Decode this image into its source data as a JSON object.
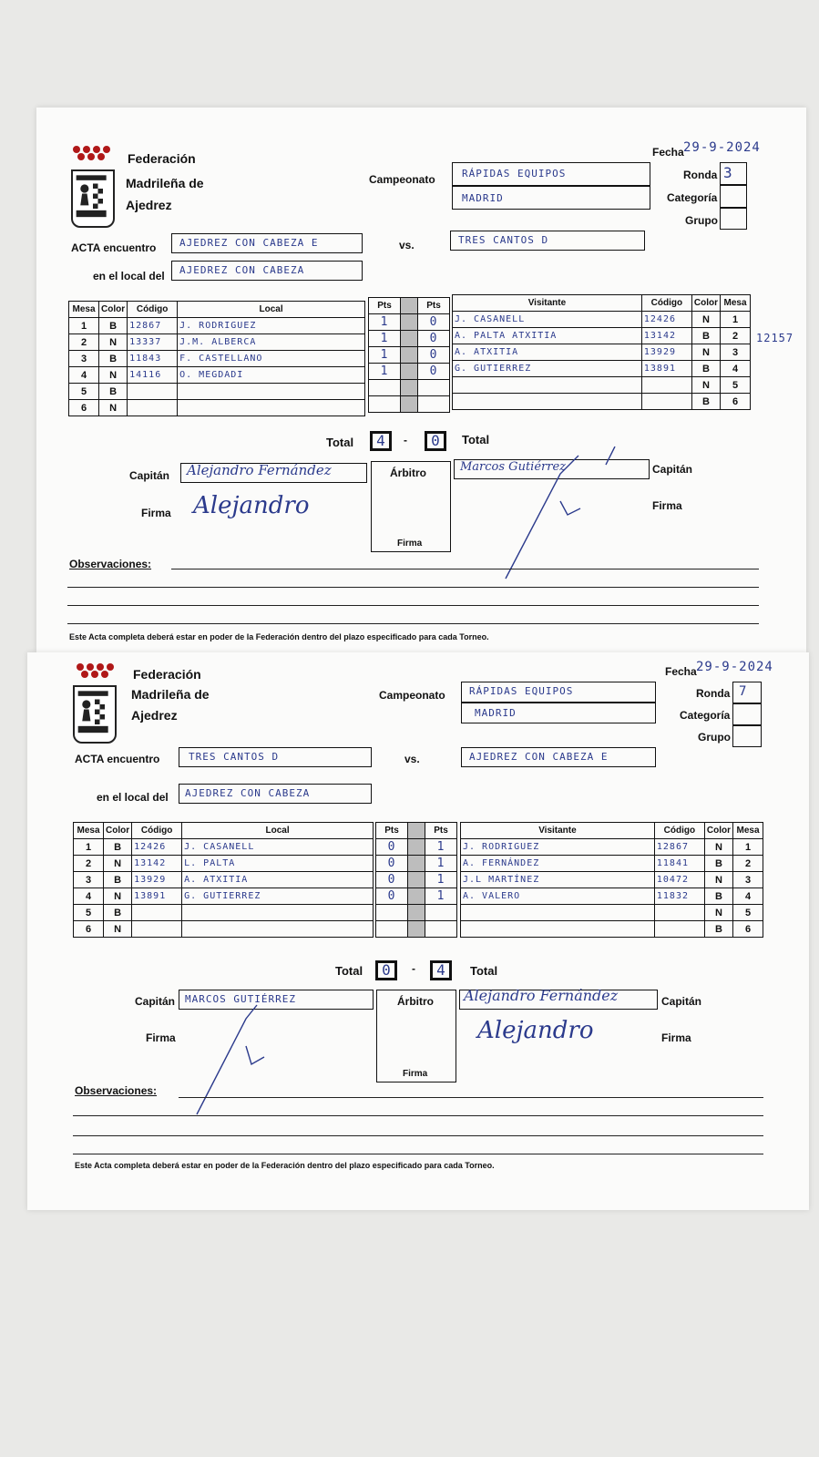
{
  "forms": [
    {
      "federation": {
        "line1": "Federación",
        "line2": "Madrileña de",
        "line3": "Ajedrez"
      },
      "fecha_label": "Fecha",
      "fecha_value": "29-9-2024",
      "campeonato_label": "Campeonato",
      "campeonato_line1": "RÁPIDAS EQUIPOS",
      "campeonato_line2": "MADRID",
      "ronda_label": "Ronda",
      "ronda_value": "3",
      "categoria_label": "Categoría",
      "categoria_value": "",
      "grupo_label": "Grupo",
      "grupo_value": "",
      "acta_label": "ACTA encuentro",
      "acta_local": "AJEDREZ CON CABEZA E",
      "vs_label": "vs.",
      "acta_visitante": "TRES CANTOS D",
      "local_label": "en el local del",
      "local_value": "AJEDREZ CON CABEZA",
      "headers": {
        "mesa": "Mesa",
        "color": "Color",
        "codigo": "Código",
        "local": "Local",
        "pts": "Pts",
        "visitante": "Visitante"
      },
      "rows": [
        {
          "mesa": "1",
          "color_l": "B",
          "codigo_l": "12867",
          "local": "J. RODRIGUEZ",
          "pts_l": "1",
          "pts_v": "0",
          "visitante": "J. CASANELL",
          "codigo_v": "12426",
          "color_v": "N"
        },
        {
          "mesa": "2",
          "color_l": "N",
          "codigo_l": "13337",
          "local": "J.M. ALBERCA",
          "pts_l": "1",
          "pts_v": "0",
          "visitante": "A. PALTA ATXITIA",
          "codigo_v": "13142",
          "color_v": "B"
        },
        {
          "mesa": "3",
          "color_l": "B",
          "codigo_l": "11843",
          "local": "F. CASTELLANO",
          "pts_l": "1",
          "pts_v": "0",
          "visitante": "A. ATXITIA",
          "codigo_v": "13929",
          "color_v": "N"
        },
        {
          "mesa": "4",
          "color_l": "N",
          "codigo_l": "14116",
          "local": "O. MEGDADI",
          "pts_l": "1",
          "pts_v": "0",
          "visitante": "G. GUTIERREZ",
          "codigo_v": "13891",
          "color_v": "B"
        },
        {
          "mesa": "5",
          "color_l": "B",
          "codigo_l": "",
          "local": "",
          "pts_l": "",
          "pts_v": "",
          "visitante": "",
          "codigo_v": "",
          "color_v": "N"
        },
        {
          "mesa": "6",
          "color_l": "N",
          "codigo_l": "",
          "local": "",
          "pts_l": "",
          "pts_v": "",
          "visitante": "",
          "codigo_v": "",
          "color_v": "B"
        }
      ],
      "margin_note": "12157",
      "total_label": "Total",
      "total_local": "4",
      "total_sep": "-",
      "total_visitante": "0",
      "capitan_label": "Capitán",
      "capitan_local": "Alejandro Fernández",
      "capitan_visitante": "Marcos Gutiérrez",
      "arbitro_label": "Árbitro",
      "firma_label": "Firma",
      "firma_local": "Alejandro",
      "observaciones_label": "Observaciones:",
      "footer": "Este Acta completa deberá estar en poder de la Federación dentro del plazo especificado para cada Torneo."
    },
    {
      "federation": {
        "line1": "Federación",
        "line2": "Madrileña de",
        "line3": "Ajedrez"
      },
      "fecha_label": "Fecha",
      "fecha_value": "29-9-2024",
      "campeonato_label": "Campeonato",
      "campeonato_line1": "RÁPIDAS EQUIPOS",
      "campeonato_line2": "MADRID",
      "ronda_label": "Ronda",
      "ronda_value": "7",
      "categoria_label": "Categoría",
      "categoria_value": "",
      "grupo_label": "Grupo",
      "grupo_value": "",
      "acta_label": "ACTA encuentro",
      "acta_local": "TRES CANTOS D",
      "vs_label": "vs.",
      "acta_visitante": "AJEDREZ CON CABEZA E",
      "local_label": "en el local del",
      "local_value": "AJEDREZ CON CABEZA",
      "headers": {
        "mesa": "Mesa",
        "color": "Color",
        "codigo": "Código",
        "local": "Local",
        "pts": "Pts",
        "visitante": "Visitante"
      },
      "rows": [
        {
          "mesa": "1",
          "color_l": "B",
          "codigo_l": "12426",
          "local": "J. CASANELL",
          "pts_l": "0",
          "pts_v": "1",
          "visitante": "J. RODRIGUEZ",
          "codigo_v": "12867",
          "color_v": "N"
        },
        {
          "mesa": "2",
          "color_l": "N",
          "codigo_l": "13142",
          "local": "L. PALTA",
          "pts_l": "0",
          "pts_v": "1",
          "visitante": "A. FERNÁNDEZ",
          "codigo_v": "11841",
          "color_v": "B"
        },
        {
          "mesa": "3",
          "color_l": "B",
          "codigo_l": "13929",
          "local": "A. ATXITIA",
          "pts_l": "0",
          "pts_v": "1",
          "visitante": "J.L MARTÍNEZ",
          "codigo_v": "10472",
          "color_v": "N"
        },
        {
          "mesa": "4",
          "color_l": "N",
          "codigo_l": "13891",
          "local": "G. GUTIERREZ",
          "pts_l": "0",
          "pts_v": "1",
          "visitante": "A. VALERO",
          "codigo_v": "11832",
          "color_v": "B"
        },
        {
          "mesa": "5",
          "color_l": "B",
          "codigo_l": "",
          "local": "",
          "pts_l": "",
          "pts_v": "",
          "visitante": "",
          "codigo_v": "",
          "color_v": "N"
        },
        {
          "mesa": "6",
          "color_l": "N",
          "codigo_l": "",
          "local": "",
          "pts_l": "",
          "pts_v": "",
          "visitante": "",
          "codigo_v": "",
          "color_v": "B"
        }
      ],
      "total_label": "Total",
      "total_local": "0",
      "total_sep": "-",
      "total_visitante": "4",
      "capitan_label": "Capitán",
      "capitan_local": "MARCOS GUTIÉRREZ",
      "capitan_visitante": "Alejandro Fernández",
      "arbitro_label": "Árbitro",
      "firma_label": "Firma",
      "firma_visitante": "Alejandro",
      "observaciones_label": "Observaciones:",
      "footer": "Este Acta completa deberá estar en poder de la Federación dentro del plazo especificado para cada Torneo."
    }
  ],
  "colors": {
    "ink": "#2b3a8c",
    "paper": "#fbfbfa",
    "background": "#e9e9e7"
  }
}
